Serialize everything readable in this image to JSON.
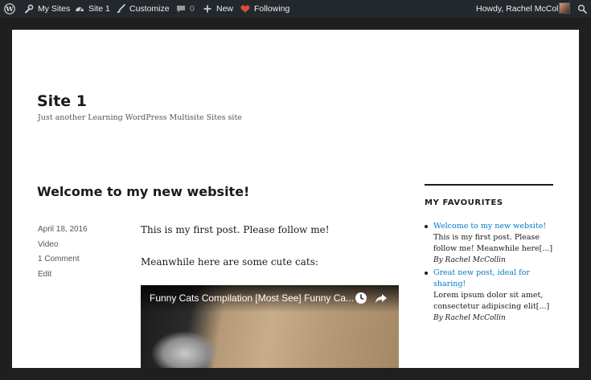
{
  "adminbar": {
    "my_sites": "My Sites",
    "site": "Site 1",
    "customize": "Customize",
    "comments_count": "0",
    "new": "New",
    "following": "Following",
    "howdy": "Howdy, Rachel McCollin",
    "icons": {
      "logo": "wordpress-logo-icon",
      "my_sites": "wrench-icon",
      "site": "dashboard-gauge-icon",
      "customize": "paintbrush-icon",
      "comments": "comment-bubble-icon",
      "new": "plus-icon",
      "following": "heart-icon",
      "search": "search-icon"
    },
    "colors": {
      "bar": "#23282d",
      "heart": "#dd4b39"
    }
  },
  "site": {
    "title": "Site 1",
    "tagline": "Just another Learning WordPress Multisite Sites site"
  },
  "post": {
    "title": "Welcome to my new website!",
    "date": "April 18, 2016",
    "format": "Video",
    "comments": "1 Comment",
    "edit": "Edit",
    "paragraph1": "This is my first post. Please follow me!",
    "paragraph2": "Meanwhile here are some cute cats:",
    "video_title": "Funny Cats Compilation [Most See] Funny Ca...",
    "video_icons": [
      "clock-icon",
      "share-arrow-icon"
    ]
  },
  "sidebar": {
    "widget_title": "MY FAVOURITES",
    "link_color": "#007acc",
    "items": [
      {
        "link": "Welcome to my new website!",
        "excerpt": "This is my first post. Please follow me! Meanwhile here[...]",
        "author": "By Rachel McCollin"
      },
      {
        "link": "Great new post, ideal for sharing!",
        "excerpt": "Lorem ipsum dolor sit amet, consectetur adipiscing elit[...]",
        "author": "By Rachel McCollin"
      }
    ]
  }
}
